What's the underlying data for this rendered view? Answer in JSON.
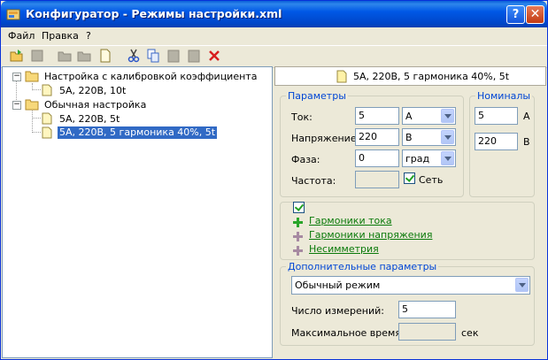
{
  "window": {
    "title": "Конфигуратор - Режимы настройки.xml",
    "help_label": "?",
    "close_label": "✕"
  },
  "menu": [
    "Файл",
    "Правка",
    "?"
  ],
  "toolbar_icons": [
    "open-folder-icon",
    "disabled-icon",
    "folder-icon",
    "folder-icon",
    "new-document-icon",
    "cut-icon",
    "copy-icon",
    "paste-icon",
    "paste-icon",
    "delete-icon"
  ],
  "tree": {
    "groups": [
      {
        "label": "Настройка с калибровкой коэффициента",
        "children": [
          "5А, 220В, 10t"
        ]
      },
      {
        "label": "Обычная настройка",
        "children": [
          "5А, 220В, 5t",
          "5А, 220В, 5 гармоника 40%, 5t"
        ]
      }
    ]
  },
  "header": {
    "title": "5А, 220В, 5 гармоника 40%, 5t"
  },
  "params": {
    "legend": "Параметры",
    "current_label": "Ток:",
    "current_value": "5",
    "current_unit": "А",
    "voltage_label": "Напряжение:",
    "voltage_value": "220",
    "voltage_unit": "В",
    "phase_label": "Фаза:",
    "phase_value": "0",
    "phase_unit": "град",
    "freq_label": "Частота:",
    "freq_value": "",
    "network_label": "Сеть",
    "network_checked": true
  },
  "nominals": {
    "legend": "Номиналы",
    "current_value": "5",
    "current_unit": "А",
    "voltage_value": "220",
    "voltage_unit": "В"
  },
  "harmonics": {
    "enabled": true,
    "items": [
      {
        "label": "Гармоники тока",
        "active": true
      },
      {
        "label": "Гармоники напряжения",
        "active": false
      },
      {
        "label": "Несимметрия",
        "active": false
      }
    ]
  },
  "extra": {
    "legend": "Дополнительные параметры",
    "mode_value": "Обычный режим",
    "count_label": "Число измерений:",
    "count_value": "5",
    "maxtime_label": "Максимальное время:",
    "maxtime_value": "",
    "maxtime_unit": "сек"
  },
  "colors": {
    "titlebar": "#0058e6",
    "link": "#0a7a0a",
    "legend": "#0046d5",
    "selection": "#316ac5"
  }
}
